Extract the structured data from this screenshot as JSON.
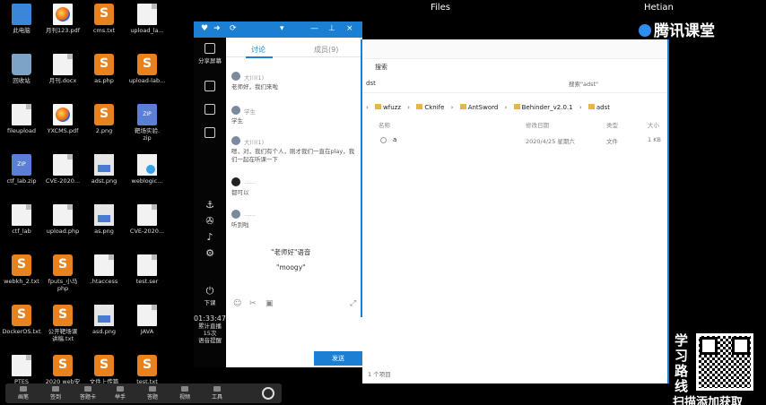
{
  "desktop_icons": [
    {
      "label": "此电脑",
      "kind": "pc"
    },
    {
      "label": "月刊123.pdf",
      "kind": "pdf"
    },
    {
      "label": "cms.txt",
      "kind": "orange"
    },
    {
      "label": "upload_la...",
      "kind": "doc"
    },
    {
      "label": "回收站",
      "kind": "bin"
    },
    {
      "label": "月刊.docx",
      "kind": "doc"
    },
    {
      "label": "as.php",
      "kind": "orange"
    },
    {
      "label": "upload-lab...",
      "kind": "orange"
    },
    {
      "label": "fileupload",
      "kind": "doc"
    },
    {
      "label": "YXCMS.pdf",
      "kind": "pdf"
    },
    {
      "label": "2.png",
      "kind": "orange"
    },
    {
      "label": "靶场实验.\nzip",
      "kind": "zip"
    },
    {
      "label": "ctf_lab.zip",
      "kind": "zip"
    },
    {
      "label": "CVE-2020...",
      "kind": "doc"
    },
    {
      "label": "adst.png",
      "kind": "img"
    },
    {
      "label": "weblogic...",
      "kind": "web"
    },
    {
      "label": "ctf_lab",
      "kind": "doc"
    },
    {
      "label": "upload.php",
      "kind": "doc"
    },
    {
      "label": "as.png",
      "kind": "img"
    },
    {
      "label": "CVE-2020...",
      "kind": "doc"
    },
    {
      "label": "webkh_2.txt",
      "kind": "orange"
    },
    {
      "label": "fputs_小马\nphp",
      "kind": "orange"
    },
    {
      "label": ".htaccess",
      "kind": "doc"
    },
    {
      "label": "test.ser",
      "kind": "doc"
    },
    {
      "label": "DockerOS.txt",
      "kind": "orange"
    },
    {
      "label": "公开靶场课\n讲稿.txt",
      "kind": "orange"
    },
    {
      "label": "asd.png",
      "kind": "img"
    },
    {
      "label": "JAVA",
      "kind": "doc"
    },
    {
      "label": "PTES",
      "kind": "doc"
    },
    {
      "label": "2020 web安",
      "kind": "orange"
    },
    {
      "label": "文件上传篇",
      "kind": "orange"
    },
    {
      "label": "test.txt",
      "kind": "orange"
    }
  ],
  "top_bar": {
    "files_title": "Files",
    "hetian_title": "Hetian",
    "tencent_logo": "腾讯课堂"
  },
  "chat": {
    "left_items": [
      {
        "label": "分享屏幕"
      },
      {
        "label": "下课"
      }
    ],
    "tabs": [
      "讨论",
      "成员(9)"
    ],
    "messages": [
      {
        "name": "大川(1)",
        "text": "老师好，我们来啦"
      },
      {
        "name": "学生",
        "text": "学生"
      },
      {
        "name": "大川(1)",
        "text": "嗯，对，我们有个人，刚才我们一直在play，我们一起在听课一下"
      },
      {
        "name": "……",
        "text": "都可以"
      },
      {
        "name": "……",
        "text": "听到啦"
      }
    ],
    "bubbles": [
      "\"老师好\"语音",
      "\"moogy\""
    ],
    "send_label": "发送",
    "clock_time": "01:33:47",
    "clock_caption": "累计直播\n15次\n语音提醒"
  },
  "explorer": {
    "tab_label": "搜索",
    "path_left": "dst",
    "search_placeholder": "搜索\"adst\"",
    "breadcrumbs": [
      "wfuzz",
      "Cknife",
      "AntSword",
      "Behinder_v2.0.1",
      "adst"
    ],
    "columns": [
      "名称",
      "修改日期",
      "类型",
      "大小"
    ],
    "rows": [
      {
        "name": "a",
        "date": "2020/4/25 星期六",
        "type": "文件",
        "size": "1 KB"
      }
    ],
    "status": "1 个项目"
  },
  "promo": {
    "side_text": "学习路线",
    "bottom_text": "扫描添加获取"
  },
  "bottom_bar": [
    "画笔",
    "签到",
    "答题卡",
    "举手",
    "答题",
    "视频",
    "工具"
  ]
}
